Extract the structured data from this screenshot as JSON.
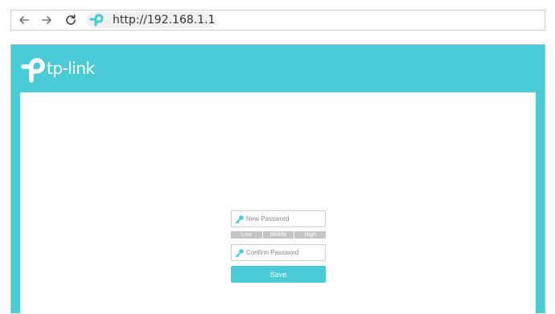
{
  "browser": {
    "url": "http://192.168.1.1"
  },
  "header": {
    "brand": "tp-link",
    "accent_color": "#4acbd6"
  },
  "form": {
    "new_password_placeholder": "New Password",
    "confirm_password_placeholder": "Confirm Password",
    "strength_levels": [
      "Low",
      "Middle",
      "High"
    ],
    "save_label": "Save"
  },
  "icons": {
    "back": "arrow-left",
    "forward": "arrow-right",
    "reload": "reload",
    "site": "tp-link-logo",
    "field": "key"
  }
}
